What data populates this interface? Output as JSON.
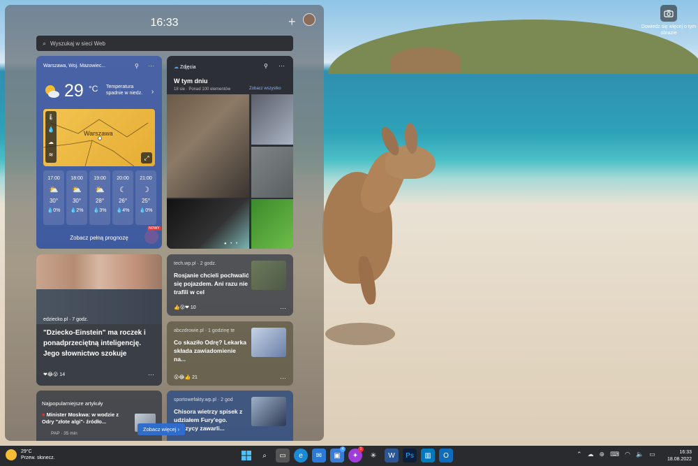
{
  "desktop": {
    "camera_label": "Dowiedz się więcej o tym obrazie"
  },
  "panel": {
    "time": "16:33",
    "search_placeholder": "Wyszukaj w sieci Web"
  },
  "weather": {
    "location": "Warszawa, Woj. Mazowiec...",
    "temp": "29",
    "unit": "°C",
    "note": "Temperatura spadnie w niedz.",
    "map_city": "Warszawa",
    "hours": [
      {
        "time": "17:00",
        "icon": "sun-cloud-icon",
        "temp": "30°",
        "rain": "0%"
      },
      {
        "time": "18:00",
        "icon": "sun-cloud-icon",
        "temp": "30°",
        "rain": "2%"
      },
      {
        "time": "19:00",
        "icon": "sun-cloud-icon",
        "temp": "28°",
        "rain": "3%"
      },
      {
        "time": "20:00",
        "icon": "moon-cloud-icon",
        "temp": "26°",
        "rain": "4%"
      },
      {
        "time": "21:00",
        "icon": "moon-icon",
        "temp": "25°",
        "rain": "0%"
      }
    ],
    "full_forecast": "Zobacz pełną prognozę",
    "new_badge": "NOWY"
  },
  "photos": {
    "header": "Zdjęcia",
    "title": "W tym dniu",
    "subtitle": "18 sie · Ponad 100 elementów",
    "see_all": "Zobacz wszystko"
  },
  "news": [
    {
      "source": "tech.wp.pl · 2 godz.",
      "headline": "Rosjanie chcieli pochwalić się pojazdem. Ani razu nie trafili w cel",
      "reactions": "10"
    },
    {
      "source": "abczdrowie.pl · 1 godzinę te",
      "headline": "Co skaziło Odrę? Lekarka składa zawiadomienie na...",
      "reactions": "21"
    },
    {
      "source": "sportowefakty.wp.pl · 2 god",
      "headline": "Chisora wietrzy spisek z udziałem Fury'ego. ...yczycy zawarli..."
    }
  ],
  "baby_card": {
    "source": "edziecko.pl · 7 godz.",
    "headline": "\"Dziecko-Einstein\" ma roczek i ponadprzeciętną inteligencję. Jego słownictwo szokuje",
    "reactions": "14"
  },
  "popular": {
    "header": "Najpopularniejsze artykuły",
    "item": "Minister Moskwa: w wodzie z Odry \"złote algi\"- źródło...",
    "time": "PAP · 35 min"
  },
  "see_more": "Zobacz więcej",
  "taskbar": {
    "weather_temp": "29°C",
    "weather_desc": "Przew. słonecz.",
    "clock_time": "16:33",
    "clock_date": "18.08.2022",
    "icons": [
      "windows-icon",
      "search-icon",
      "task-view-icon",
      "edge-icon",
      "mail-icon",
      "store-icon",
      "messenger-icon",
      "slack-icon",
      "word-icon",
      "photoshop-icon",
      "trello-icon",
      "outlook-icon"
    ],
    "badges": {
      "store": "4",
      "messenger": "1"
    }
  }
}
